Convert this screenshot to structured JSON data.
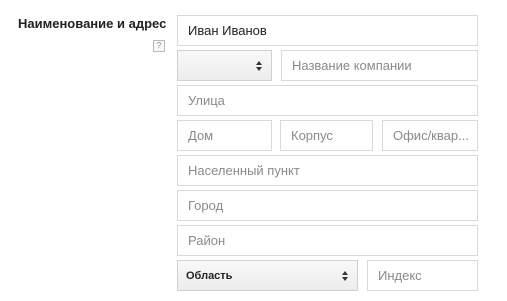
{
  "section": {
    "label": "Наименование и адрес",
    "help": "?"
  },
  "fields": {
    "name_value": "Иван Иванов",
    "company_placeholder": "Название компании",
    "street_placeholder": "Улица",
    "house_placeholder": "Дом",
    "building_placeholder": "Корпус",
    "office_placeholder": "Офис/квар...",
    "locality_placeholder": "Населенный пункт",
    "city_placeholder": "Город",
    "district_placeholder": "Район",
    "region_value": "Область",
    "postcode_placeholder": "Индекс",
    "title_select_value": ""
  }
}
